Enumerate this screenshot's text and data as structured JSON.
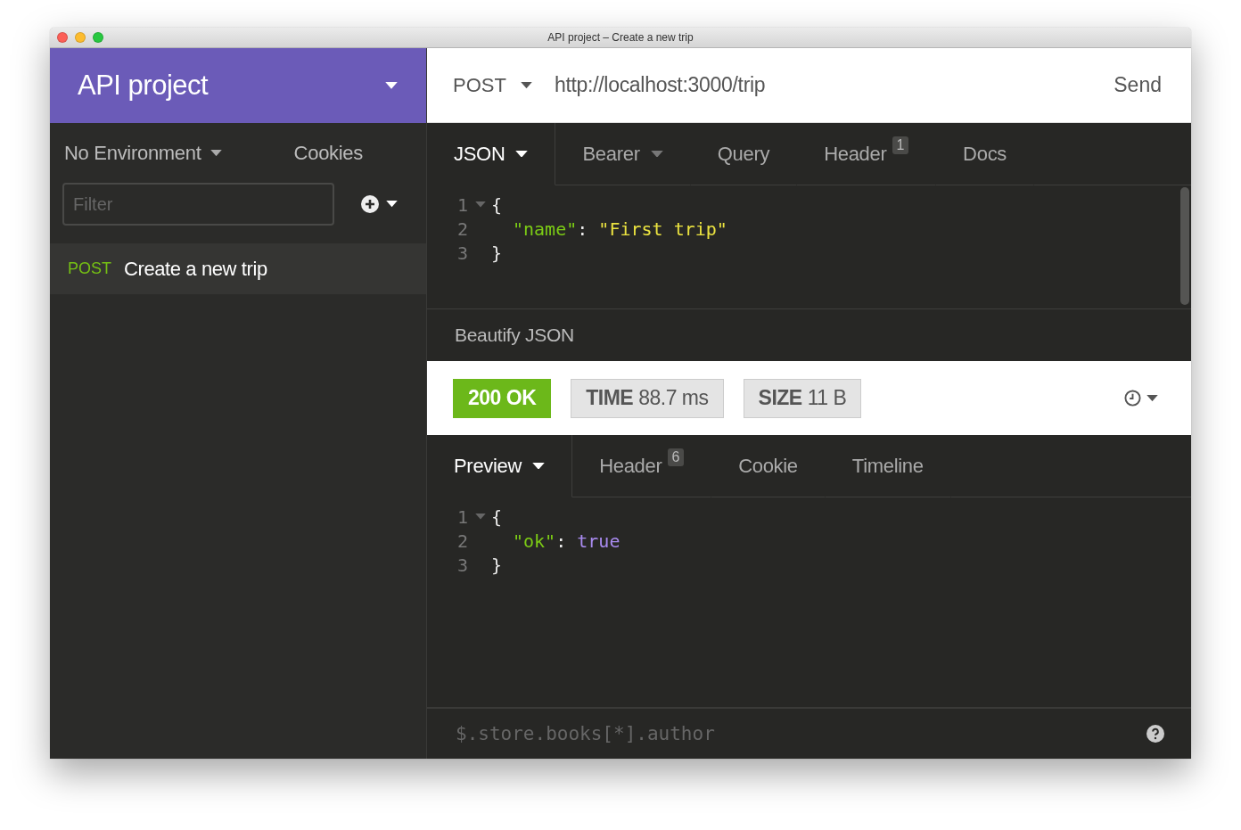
{
  "window": {
    "title": "API project – Create a new trip"
  },
  "sidebar": {
    "workspace": "API project",
    "environment": "No Environment",
    "cookies": "Cookies",
    "filter": {
      "placeholder": "Filter"
    },
    "requests": [
      {
        "method": "POST",
        "name": "Create a new trip",
        "selected": true
      }
    ]
  },
  "request": {
    "method": "POST",
    "url": "http://localhost:3000/trip",
    "send": "Send",
    "tabs": [
      {
        "label": "JSON",
        "selected": true,
        "dropdown": true
      },
      {
        "label": "Bearer",
        "selected": false,
        "dropdown": true
      },
      {
        "label": "Query",
        "selected": false,
        "dropdown": false
      },
      {
        "label": "Header",
        "selected": false,
        "dropdown": false,
        "badge": "1"
      },
      {
        "label": "Docs",
        "selected": false,
        "dropdown": false
      }
    ],
    "body": [
      {
        "number": "1",
        "fold": true,
        "tokens": [
          {
            "kind": "punct",
            "text": "{"
          }
        ]
      },
      {
        "number": "2",
        "fold": false,
        "tokens": [
          {
            "kind": "key",
            "text": "\"name\""
          },
          {
            "kind": "punct",
            "text": ": "
          },
          {
            "kind": "string",
            "text": "\"First trip\""
          }
        ]
      },
      {
        "number": "3",
        "fold": false,
        "tokens": [
          {
            "kind": "punct",
            "text": "}"
          }
        ]
      }
    ],
    "footer": "Beautify JSON"
  },
  "response": {
    "stats": [
      {
        "kind": "status",
        "text": "200 OK"
      },
      {
        "kind": "meta",
        "label": "TIME",
        "value": "88.7 ms"
      },
      {
        "kind": "meta",
        "label": "SIZE",
        "value": "11 B"
      }
    ],
    "tabs": [
      {
        "label": "Preview",
        "selected": true,
        "dropdown": true
      },
      {
        "label": "Header",
        "selected": false,
        "dropdown": false,
        "badge": "6"
      },
      {
        "label": "Cookie",
        "selected": false,
        "dropdown": false
      },
      {
        "label": "Timeline",
        "selected": false,
        "dropdown": false
      }
    ],
    "body": [
      {
        "number": "1",
        "fold": true,
        "tokens": [
          {
            "kind": "punct",
            "text": "{"
          }
        ]
      },
      {
        "number": "2",
        "fold": false,
        "tokens": [
          {
            "kind": "key",
            "text": "\"ok\""
          },
          {
            "kind": "punct",
            "text": ": "
          },
          {
            "kind": "bool",
            "text": "true"
          }
        ]
      },
      {
        "number": "3",
        "fold": false,
        "tokens": [
          {
            "kind": "punct",
            "text": "}"
          }
        ]
      }
    ],
    "query": {
      "placeholder": "$.store.books[*].author"
    }
  }
}
